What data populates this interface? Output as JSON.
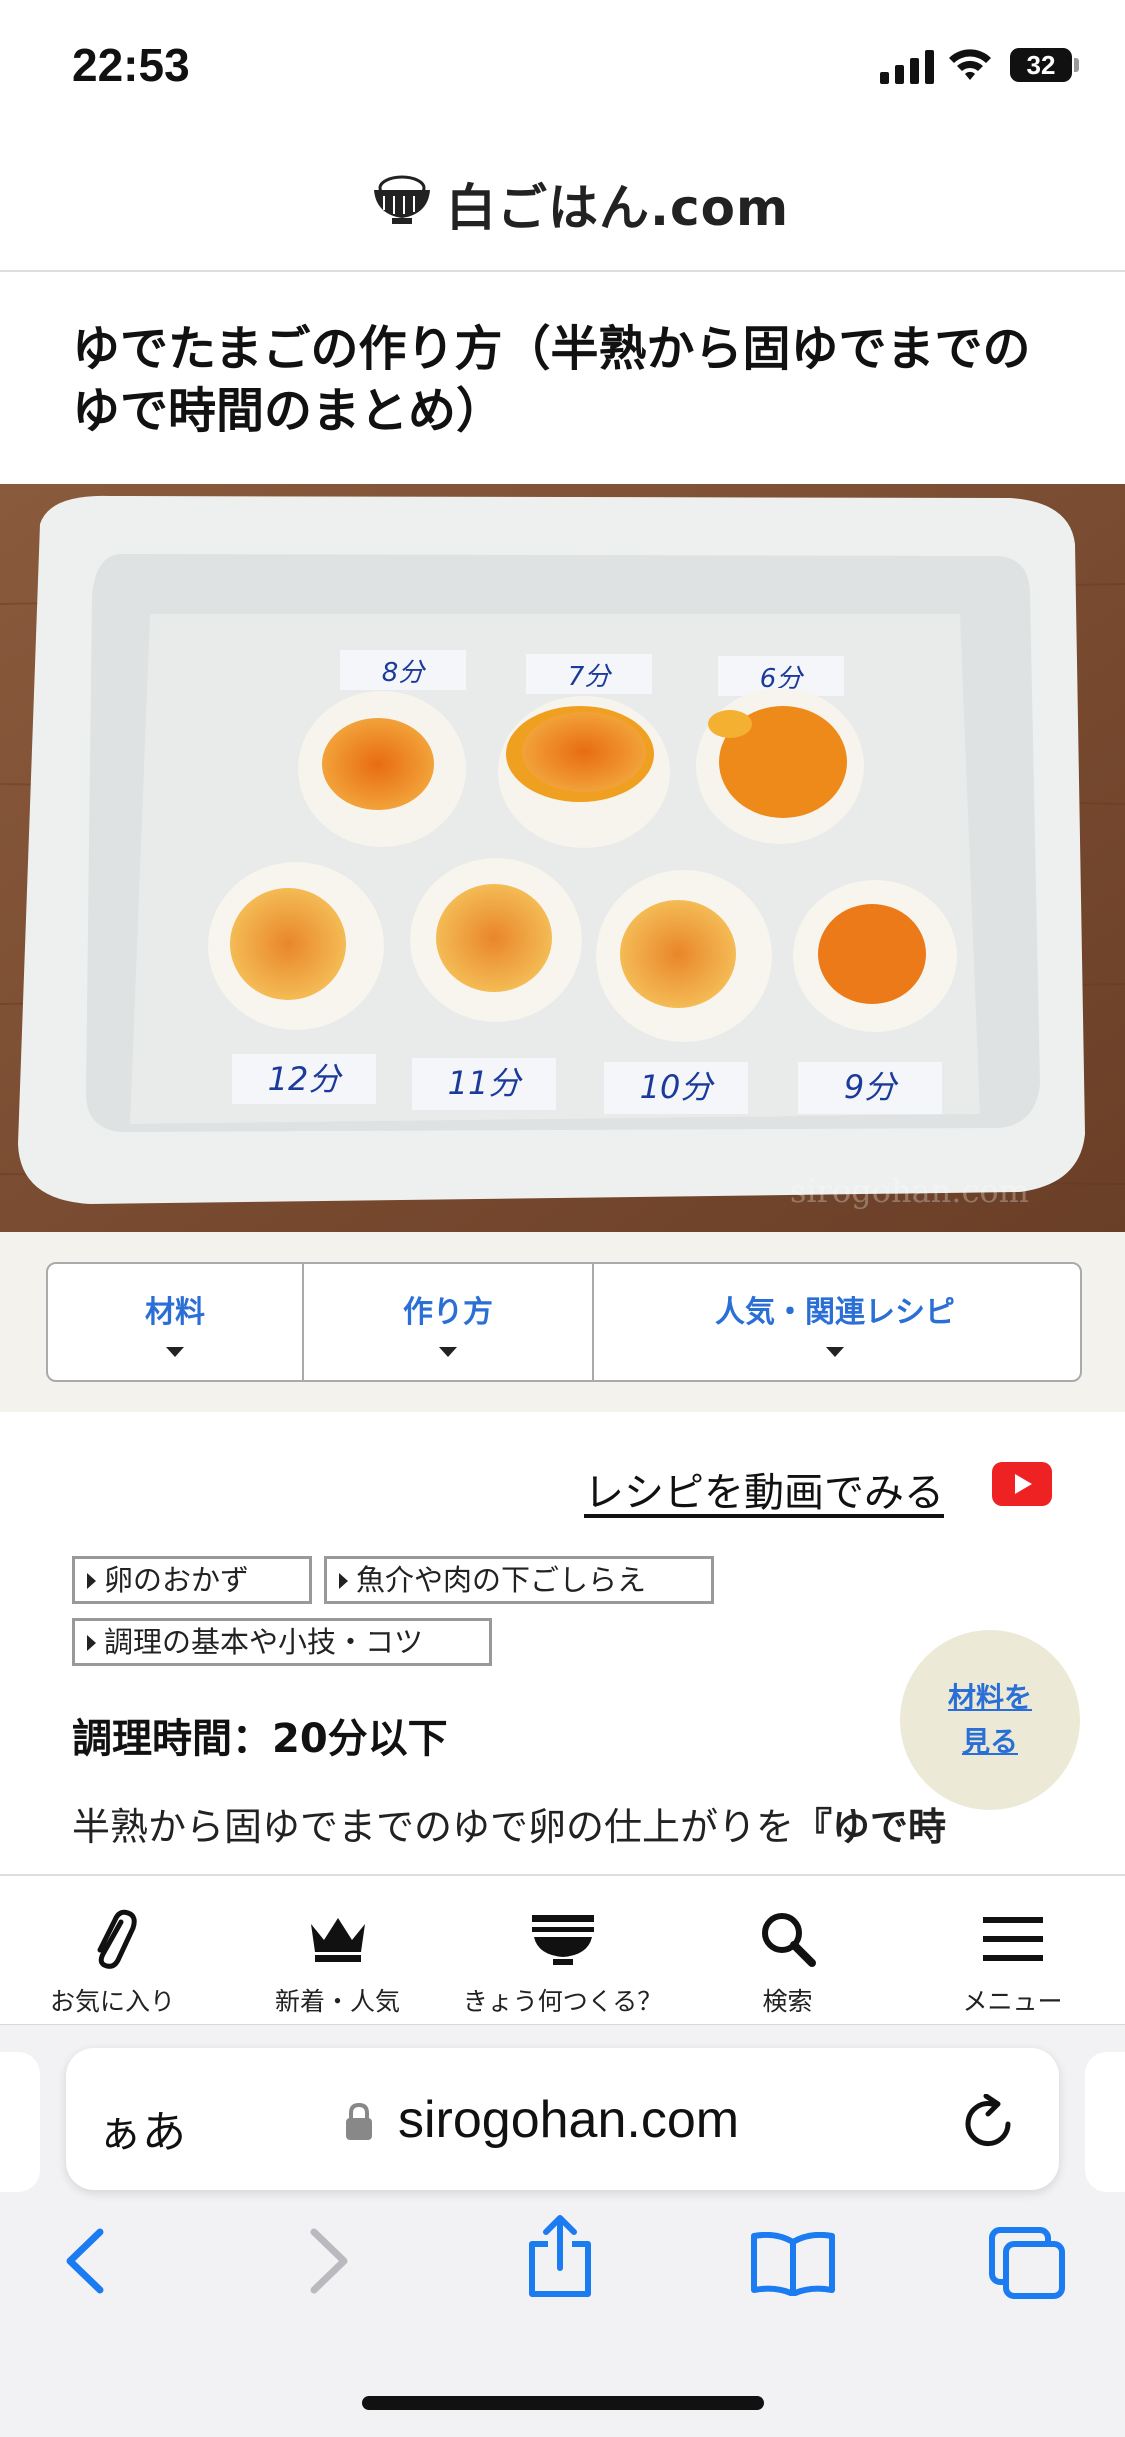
{
  "status_bar": {
    "time": "22:53",
    "battery": "32"
  },
  "header": {
    "site_name": "白ごはん.com"
  },
  "article": {
    "title": "ゆでたまごの作り方（半熟から固ゆでまでのゆで時間のまとめ）",
    "image": {
      "watermark": "sirogohan.com",
      "egg_labels": [
        "8分",
        "7分",
        "6分",
        "12分",
        "11分",
        "10分",
        "9分"
      ]
    },
    "tabs": [
      "材料",
      "作り方",
      "人気・関連レシピ"
    ],
    "video_link": "レシピを動画でみる",
    "tags": [
      "卵のおかず",
      "魚介や肉の下ごしらえ",
      "調理の基本や小技・コツ"
    ],
    "float_button": [
      "材料を",
      "見る"
    ],
    "cook_time": "調理時間：20分以下",
    "description_plain": "半熟から固ゆでまでのゆで卵の仕上がりを",
    "description_bold": "『ゆで時"
  },
  "site_toolbar": [
    {
      "label": "お気に入り",
      "icon": "paperclip-icon"
    },
    {
      "label": "新着・人気",
      "icon": "crown-icon"
    },
    {
      "label": "きょう何つくる？",
      "icon": "rice-bowl-icon"
    },
    {
      "label": "検索",
      "icon": "search-icon"
    },
    {
      "label": "メニュー",
      "icon": "menu-icon"
    }
  ],
  "browser": {
    "text_size_button": "ぁあ",
    "url": "sirogohan.com"
  },
  "colors": {
    "accent": "#2a6fd6",
    "youtube": "#e22222",
    "nav_bg": "#f4f2ec",
    "float_bg": "#ece9d6"
  }
}
